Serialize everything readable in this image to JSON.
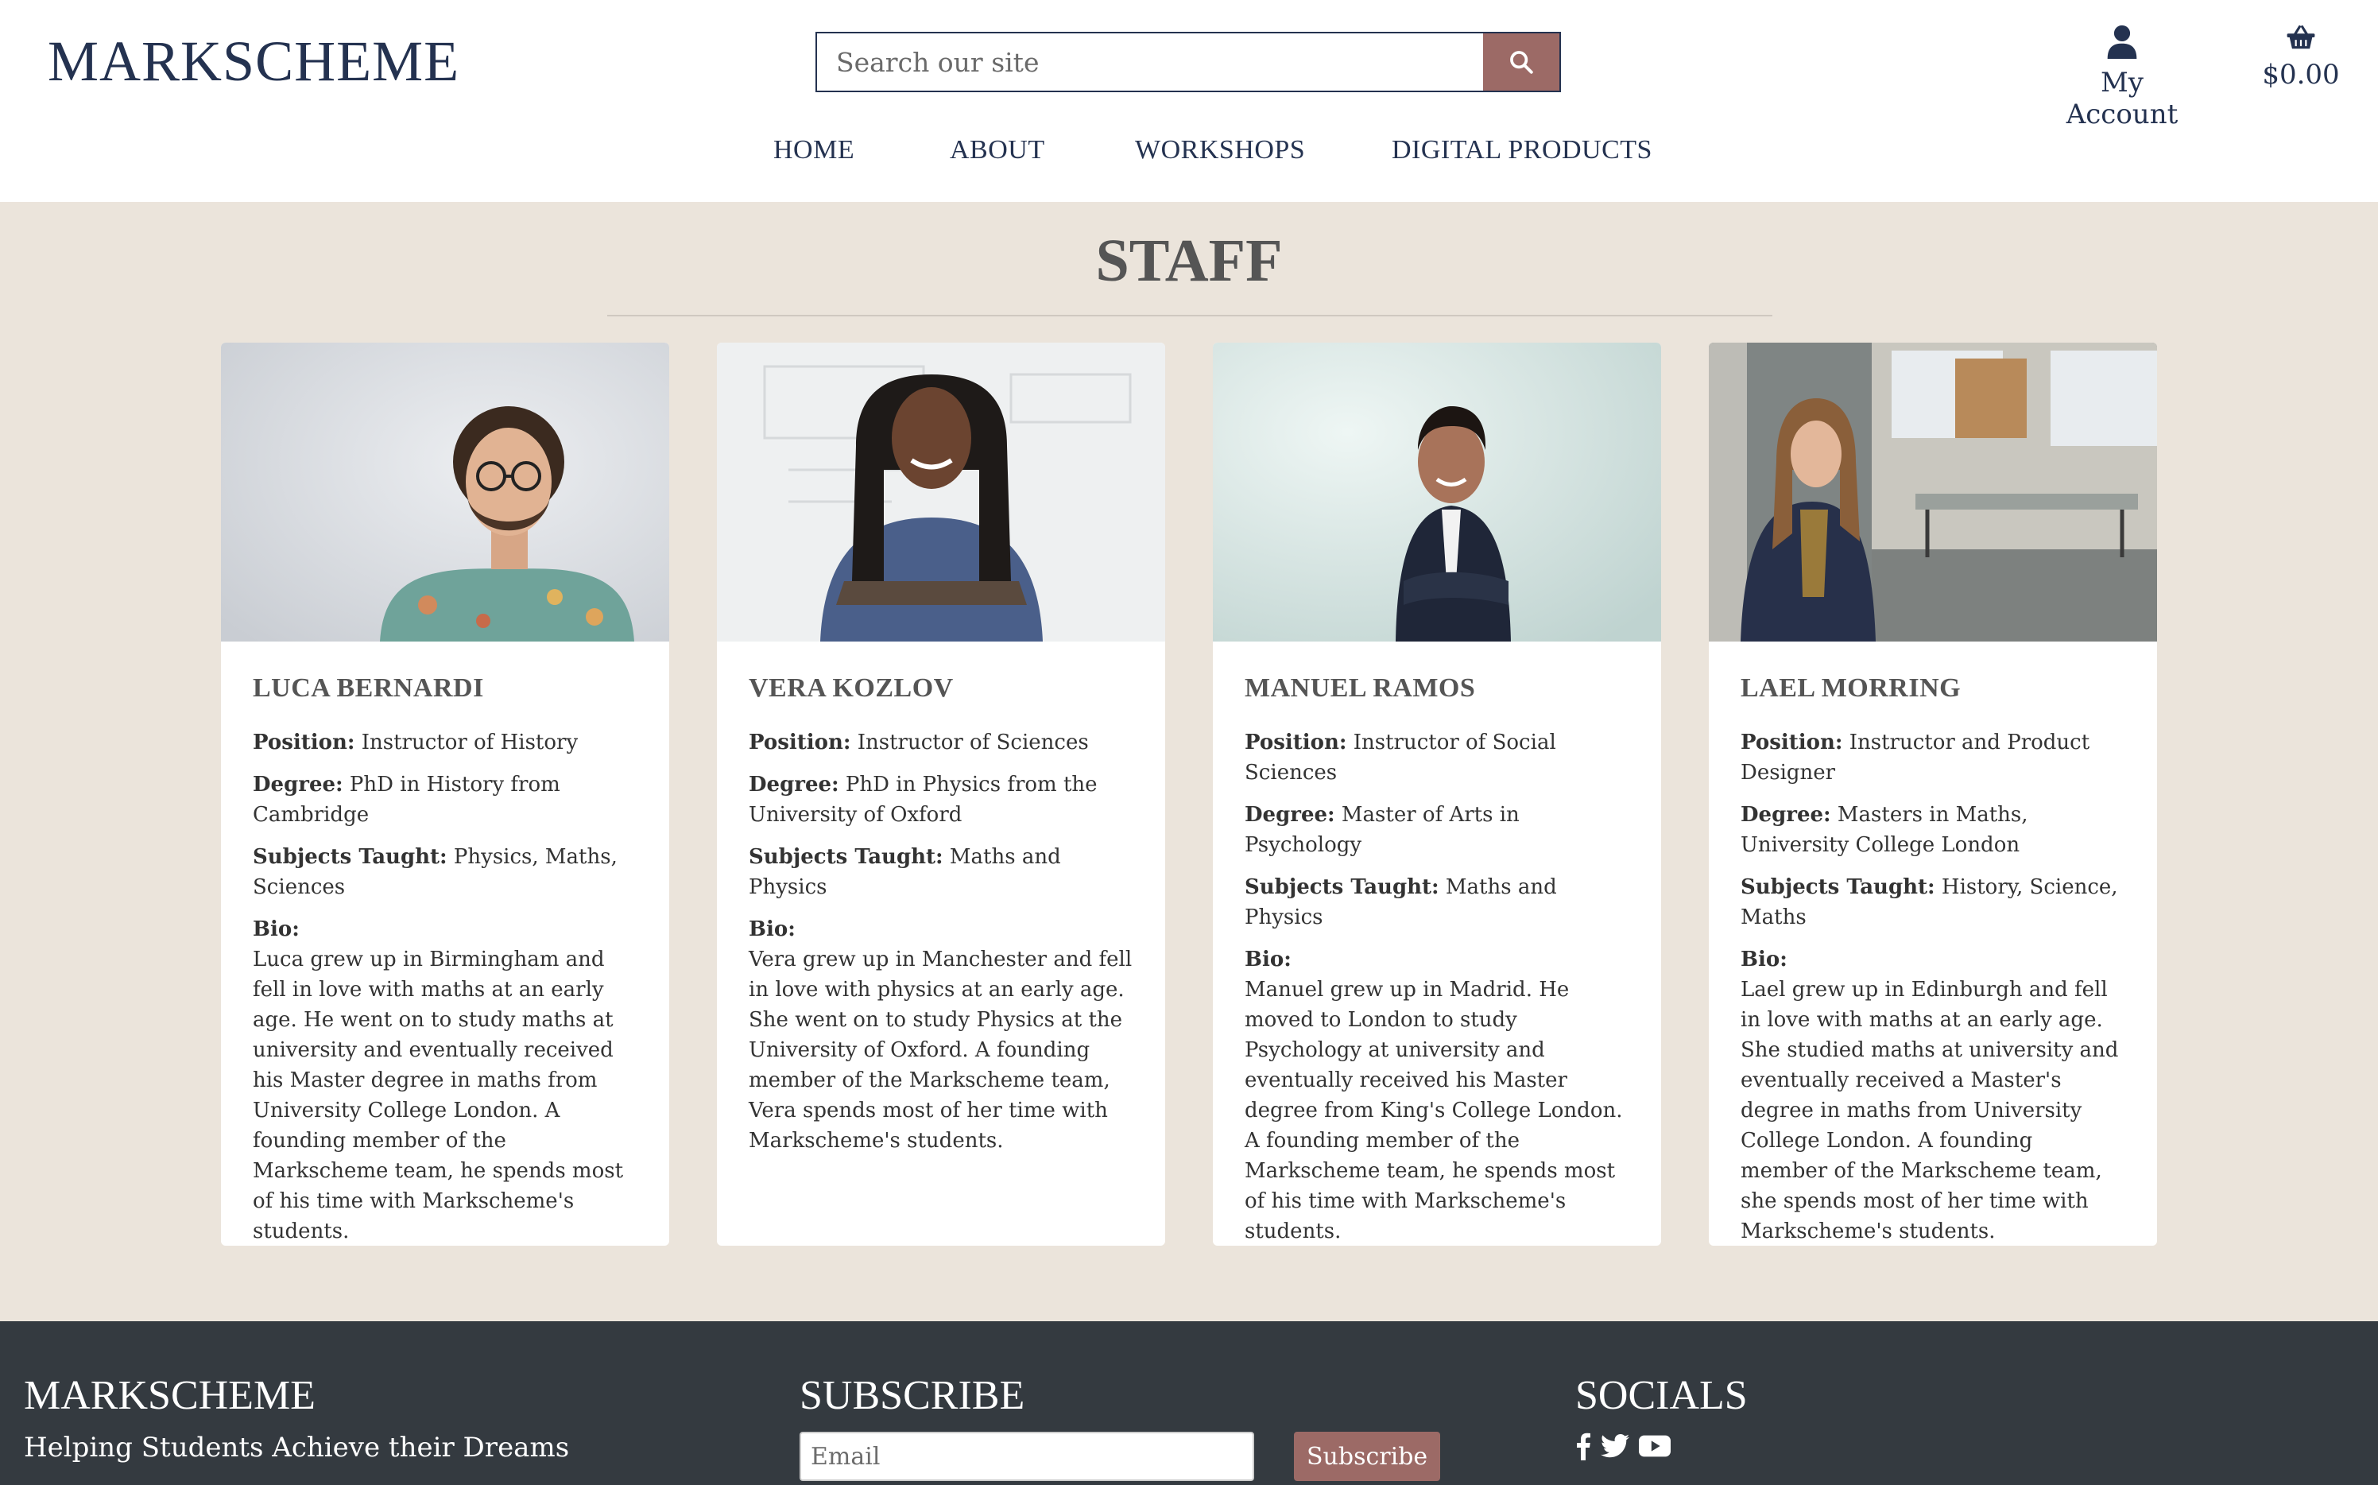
{
  "header": {
    "logo": "MARKSCHEME",
    "search_placeholder": "Search our site",
    "account_label": "My Account",
    "cart_total": "$0.00"
  },
  "nav": {
    "items": [
      "HOME",
      "ABOUT",
      "WORKSHOPS",
      "DIGITAL PRODUCTS"
    ]
  },
  "staff": {
    "title": "STAFF",
    "labels": {
      "position": "Position:",
      "degree": "Degree:",
      "subjects": "Subjects Taught:",
      "bio": "Bio:"
    },
    "members": [
      {
        "name": "LUCA BERNARDI",
        "position": "Instructor of History",
        "degree": "PhD in History from Cambridge",
        "subjects": "Physics, Maths, Sciences",
        "bio": "Luca grew up in Birmingham and fell in love with maths at an early age. He went on to study maths at university and eventually received his Master degree in maths from University College London. A founding member of the Markscheme team, he spends most of his time with Markscheme's students."
      },
      {
        "name": "VERA KOZLOV",
        "position": "Instructor of Sciences",
        "degree": "PhD in Physics from the University of Oxford",
        "subjects": "Maths and Physics",
        "bio": "Vera grew up in Manchester and fell in love with physics at an early age. She went on to study Physics at the University of Oxford. A founding member of the Markscheme team, Vera spends most of her time with Markscheme's students."
      },
      {
        "name": "MANUEL RAMOS",
        "position": "Instructor of Social Sciences",
        "degree": "Master of Arts in Psychology",
        "subjects": "Maths and Physics",
        "bio": "Manuel grew up in Madrid. He moved to London to study Psychology at university and eventually received his Master degree from King's College London. A founding member of the Markscheme team, he spends most of his time with Markscheme's students."
      },
      {
        "name": "LAEL MORRING",
        "position": "Instructor and Product Designer",
        "degree": "Masters in Maths, University College London",
        "subjects": "History, Science, Maths",
        "bio": "Lael grew up in Edinburgh and fell in love with maths at an early age. She studied maths at university and eventually received a Master's degree in maths from University College London. A founding member of the Markscheme team, she spends most of her time with Markscheme's students."
      }
    ]
  },
  "footer": {
    "brand": "MARKSCHEME",
    "tagline": "Helping Students Achieve their Dreams",
    "subscribe_heading": "SUBSCRIBE",
    "email_placeholder": "Email",
    "subscribe_button": "Subscribe",
    "socials_heading": "SOCIALS",
    "social_icons": [
      "facebook-icon",
      "twitter-icon",
      "youtube-icon"
    ]
  },
  "colors": {
    "navy": "#243250",
    "accent": "#9c6a66",
    "page_bg": "#ebe4db",
    "footer_bg": "#343a40"
  }
}
